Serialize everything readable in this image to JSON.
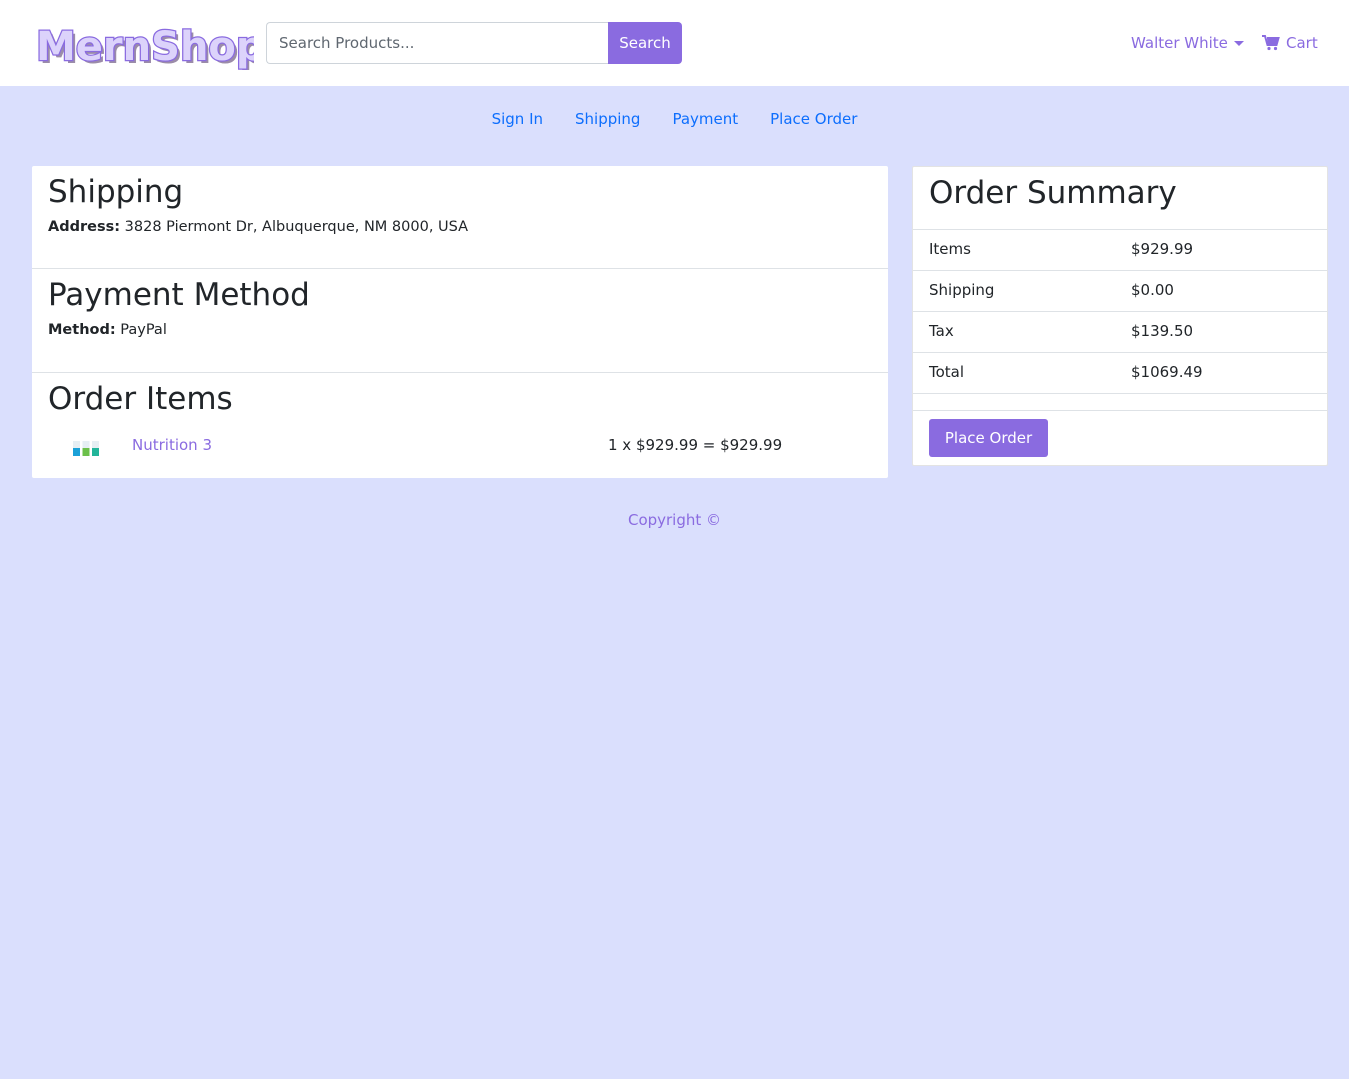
{
  "header": {
    "logo_text": "MernShop",
    "search_placeholder": "Search Products...",
    "search_button": "Search",
    "user_name": "Walter White",
    "cart_label": "Cart"
  },
  "steps": [
    "Sign In",
    "Shipping",
    "Payment",
    "Place Order"
  ],
  "shipping": {
    "title": "Shipping",
    "address_label": "Address:",
    "address_value": "3828 Piermont Dr, Albuquerque, NM 8000, USA"
  },
  "payment": {
    "title": "Payment Method",
    "method_label": "Method:",
    "method_value": "PayPal"
  },
  "order_items": {
    "title": "Order Items",
    "items": [
      {
        "name": "Nutrition 3",
        "calc": "1 x $929.99 = $929.99",
        "icon": "product-thumbnail"
      }
    ]
  },
  "summary": {
    "title": "Order Summary",
    "rows": [
      {
        "label": "Items",
        "value": "$929.99"
      },
      {
        "label": "Shipping",
        "value": "$0.00"
      },
      {
        "label": "Tax",
        "value": "$139.50"
      },
      {
        "label": "Total",
        "value": "$1069.49"
      }
    ],
    "button": "Place Order"
  },
  "footer": {
    "text": "Copyright ©"
  },
  "colors": {
    "accent": "#8a6be0",
    "background": "#dadffd",
    "link": "#0d6efd"
  }
}
